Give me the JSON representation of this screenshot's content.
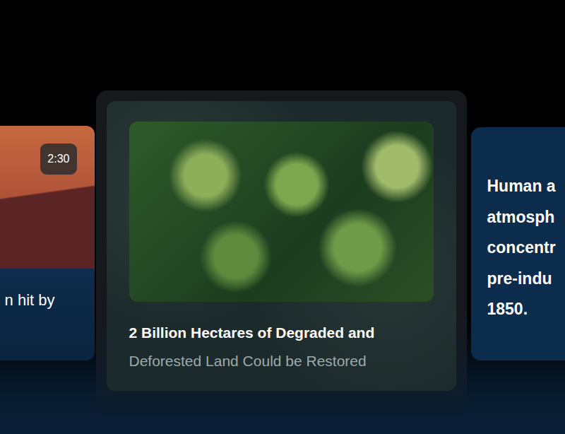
{
  "cards": [
    {
      "kind": "video",
      "selected": false,
      "duration": "2:30",
      "caption": "n hit by"
    },
    {
      "kind": "image",
      "selected": true,
      "title_lines": [
        "2 Billion Hectares of Degraded and",
        "Deforested Land Could be Restored"
      ]
    },
    {
      "kind": "text",
      "selected": false,
      "lines": [
        "Human a",
        "atmosph",
        "concentr",
        "pre-indu",
        "1850."
      ]
    }
  ]
}
